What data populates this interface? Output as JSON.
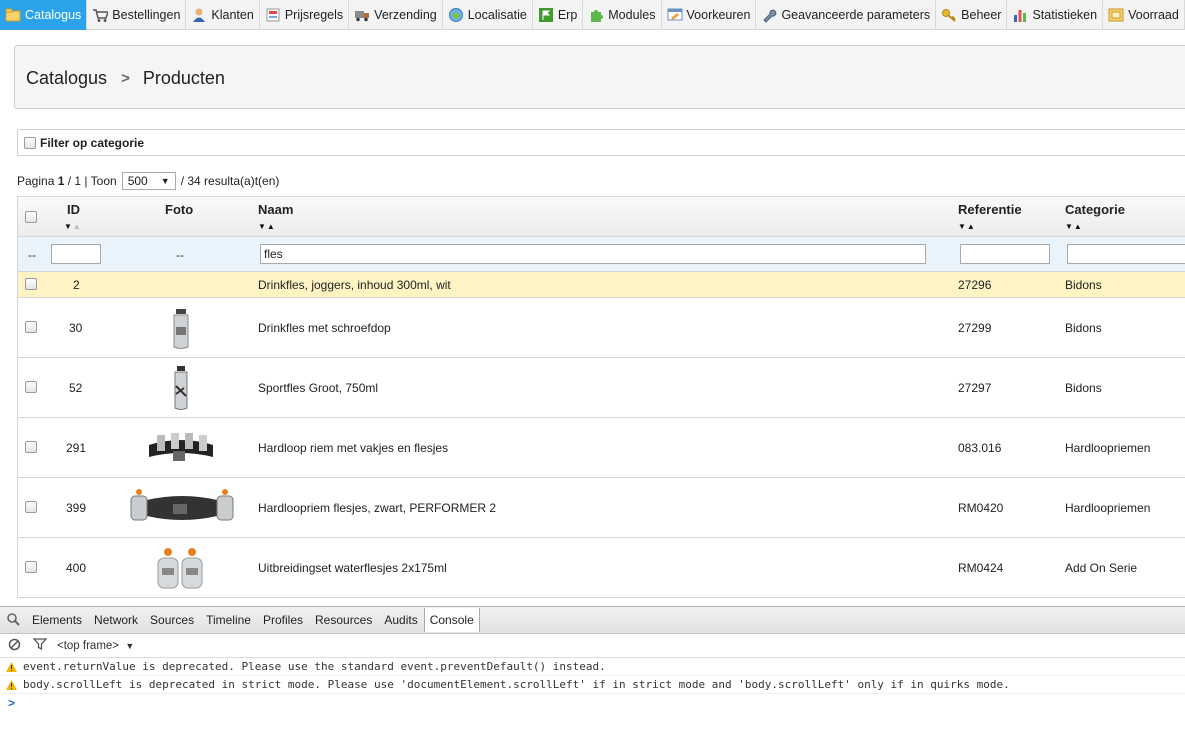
{
  "nav": [
    {
      "label": "Catalogus",
      "icon": "folder-icon",
      "active": true
    },
    {
      "label": "Bestellingen",
      "icon": "cart-icon"
    },
    {
      "label": "Klanten",
      "icon": "user-icon"
    },
    {
      "label": "Prijsregels",
      "icon": "price-rules-icon"
    },
    {
      "label": "Verzending",
      "icon": "truck-icon"
    },
    {
      "label": "Localisatie",
      "icon": "globe-icon"
    },
    {
      "label": "Erp",
      "icon": "flag-icon"
    },
    {
      "label": "Modules",
      "icon": "puzzle-icon"
    },
    {
      "label": "Voorkeuren",
      "icon": "preferences-icon"
    },
    {
      "label": "Geavanceerde parameters",
      "icon": "wrench-icon"
    },
    {
      "label": "Beheer",
      "icon": "key-icon"
    },
    {
      "label": "Statistieken",
      "icon": "bar-chart-icon"
    },
    {
      "label": "Voorraad",
      "icon": "stock-icon"
    }
  ],
  "breadcrumb": {
    "parent": "Catalogus",
    "separator": ">",
    "current": "Producten"
  },
  "filter": {
    "label": "Filter op categorie"
  },
  "pagination": {
    "prefix": "Pagina",
    "page": "1",
    "of": "/ 1 | Toon",
    "per_page": "500",
    "results": "/ 34 resulta(a)t(en)"
  },
  "table": {
    "headers": {
      "id": "ID",
      "photo": "Foto",
      "name": "Naam",
      "reference": "Referentie",
      "category": "Categorie"
    },
    "filter_row": {
      "dash_select": "--",
      "id_value": "",
      "photo_dash": "--",
      "name_value": "fles",
      "reference_value": "",
      "category_value": ""
    },
    "rows": [
      {
        "id": "2",
        "name": "Drinkfles, joggers, inhoud 300ml, wit",
        "reference": "27296",
        "category": "Bidons",
        "thumb": "none",
        "highlight": true
      },
      {
        "id": "30",
        "name": "Drinkfles met schroefdop",
        "reference": "27299",
        "category": "Bidons",
        "thumb": "bottle"
      },
      {
        "id": "52",
        "name": "Sportfles Groot, 750ml",
        "reference": "27297",
        "category": "Bidons",
        "thumb": "bottle-dark"
      },
      {
        "id": "291",
        "name": "Hardloop riem met vakjes en flesjes",
        "reference": "083.016",
        "category": "Hardloopriemen",
        "thumb": "belt-pockets"
      },
      {
        "id": "399",
        "name": "Hardloopriem flesjes, zwart, PERFORMER 2",
        "reference": "RM0420",
        "category": "Hardloopriemen",
        "thumb": "belt-wide"
      },
      {
        "id": "400",
        "name": "Uitbreidingset waterflesjes 2x175ml",
        "reference": "RM0424",
        "category": "Add On Serie",
        "thumb": "two-bottles"
      }
    ]
  },
  "devtools": {
    "tabs": [
      "Elements",
      "Network",
      "Sources",
      "Timeline",
      "Profiles",
      "Resources",
      "Audits",
      "Console"
    ],
    "active_tab": "Console",
    "frame": "<top frame>",
    "messages": [
      "event.returnValue is deprecated. Please use the standard event.preventDefault() instead.",
      "body.scrollLeft is deprecated in strict mode. Please use 'documentElement.scrollLeft' if in strict mode and 'body.scrollLeft' only if in quirks mode."
    ],
    "prompt": ">"
  },
  "colors": {
    "accent": "#2aa3ea",
    "highlight_row": "#fdf3c3",
    "filter_row": "#e9f3fb",
    "warning": "#f2b705"
  }
}
